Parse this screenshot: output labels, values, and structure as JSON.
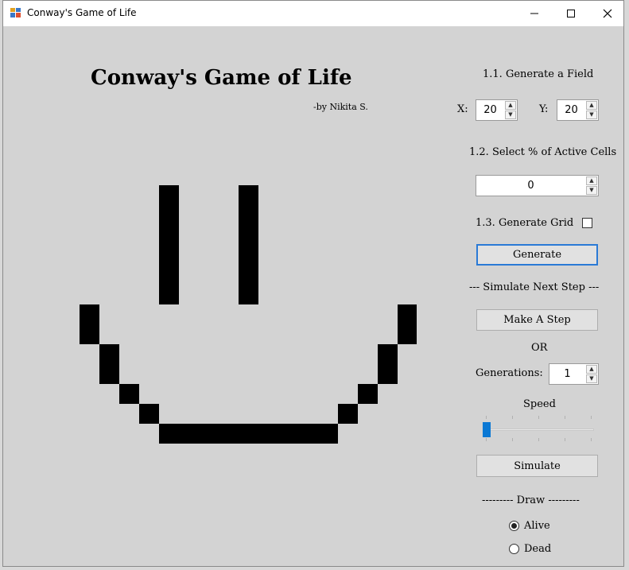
{
  "window": {
    "title": "Conway's Game of Life",
    "controls": {
      "minimize": "—",
      "maximize": "☐",
      "close": "✕"
    }
  },
  "header": {
    "title": "Conway's Game of Life",
    "byline": "-by Nikita S."
  },
  "panel": {
    "section_field": "1.1. Generate a Field",
    "x_label": "X:",
    "x_value": "20",
    "y_label": "Y:",
    "y_value": "20",
    "section_active": "1.2. Select % of Active Cells",
    "active_value": "0",
    "section_grid": "1.3. Generate Grid",
    "grid_checked": false,
    "generate_label": "Generate",
    "simulate_next_label": "--- Simulate Next Step ---",
    "make_step_label": "Make A Step",
    "or_label": "OR",
    "generations_label": "Generations:",
    "generations_value": "1",
    "speed_label": "Speed",
    "speed_level": 0,
    "simulate_label": "Simulate",
    "draw_label": "--------- Draw ---------",
    "alive_label": "Alive",
    "dead_label": "Dead",
    "draw_mode": "Alive"
  },
  "grid": {
    "columns": 20,
    "rows": 20,
    "live_cells": [
      [
        6,
        4
      ],
      [
        10,
        4
      ],
      [
        6,
        5
      ],
      [
        10,
        5
      ],
      [
        6,
        6
      ],
      [
        10,
        6
      ],
      [
        6,
        7
      ],
      [
        10,
        7
      ],
      [
        6,
        8
      ],
      [
        10,
        8
      ],
      [
        6,
        9
      ],
      [
        10,
        9
      ],
      [
        2,
        10
      ],
      [
        18,
        10
      ],
      [
        2,
        11
      ],
      [
        18,
        11
      ],
      [
        3,
        12
      ],
      [
        17,
        12
      ],
      [
        3,
        13
      ],
      [
        17,
        13
      ],
      [
        4,
        14
      ],
      [
        16,
        14
      ],
      [
        5,
        15
      ],
      [
        15,
        15
      ],
      [
        6,
        16
      ],
      [
        7,
        16
      ],
      [
        8,
        16
      ],
      [
        9,
        16
      ],
      [
        10,
        16
      ],
      [
        11,
        16
      ],
      [
        12,
        16
      ],
      [
        13,
        16
      ],
      [
        14,
        16
      ]
    ],
    "cell_color": "#000000"
  },
  "colors": {
    "background": "#d3d3d3",
    "accent": "#0a78d4"
  }
}
